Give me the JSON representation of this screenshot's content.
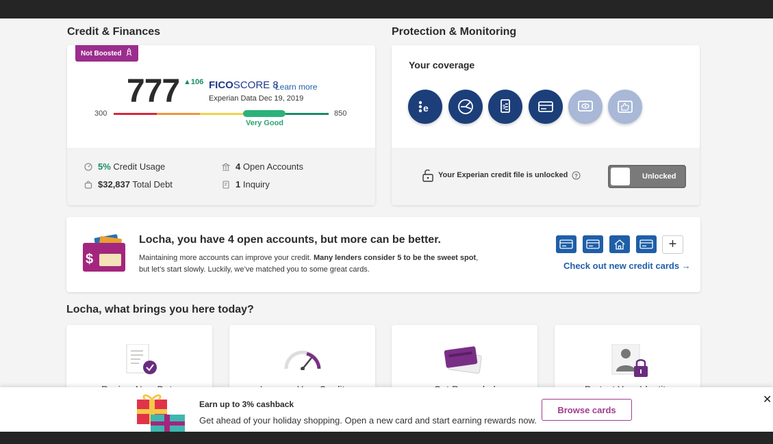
{
  "sections": {
    "credit_title": "Credit & Finances",
    "protection_title": "Protection & Monitoring"
  },
  "credit": {
    "badge": "Not Boosted",
    "score": "777",
    "delta": "106",
    "fico_brand": "FICO",
    "fico_score": "SCORE 8",
    "learn_more": "Learn more",
    "experian_data": "Experian Data Dec 19, 2019",
    "range_min": "300",
    "range_max": "850",
    "rating": "Very Good",
    "score_fraction": 0.86,
    "stats": {
      "usage_value": "5%",
      "usage_label": "Credit Usage",
      "debt_value": "$32,837",
      "debt_label": "Total Debt",
      "accounts_value": "4",
      "accounts_label": "Open Accounts",
      "inquiry_value": "1",
      "inquiry_label": "Inquiry"
    }
  },
  "coverage": {
    "title": "Your coverage",
    "icons": [
      "experian-e-icon",
      "radar-icon",
      "document-icon",
      "credit-card-icon",
      "monitor-eye-icon",
      "thumbs-up-icon"
    ],
    "lock_message": "Your Experian credit file is unlocked",
    "toggle_label": "Unlocked"
  },
  "banner": {
    "title": "Locha, you have 4 open accounts, but more can be better.",
    "text_a": "Maintaining more accounts can improve your credit. ",
    "text_bold": "Many lenders consider 5 to be the sweet spot",
    "text_b": ",",
    "text_c": "but let’s start slowly. Luckily, we’ve matched you to some great cards.",
    "link": "Check out new credit cards →"
  },
  "question": "Locha, what brings you here today?",
  "cards": [
    {
      "label": "Review New Data"
    },
    {
      "label": "Improve Your Credit"
    },
    {
      "label": "Get Rewarded"
    },
    {
      "label": "Protect Your Identity"
    }
  ],
  "promo": {
    "title": "Earn up to 3% cashback",
    "text": "Get ahead of your holiday shopping. Open a new card and start earning rewards now.",
    "button": "Browse cards",
    "close": "✕"
  },
  "colors": {
    "navy": "#1c3f7a",
    "brand_purple": "#9b2d8e",
    "link_blue": "#1f5fa8",
    "good_green": "#2bb27a"
  }
}
